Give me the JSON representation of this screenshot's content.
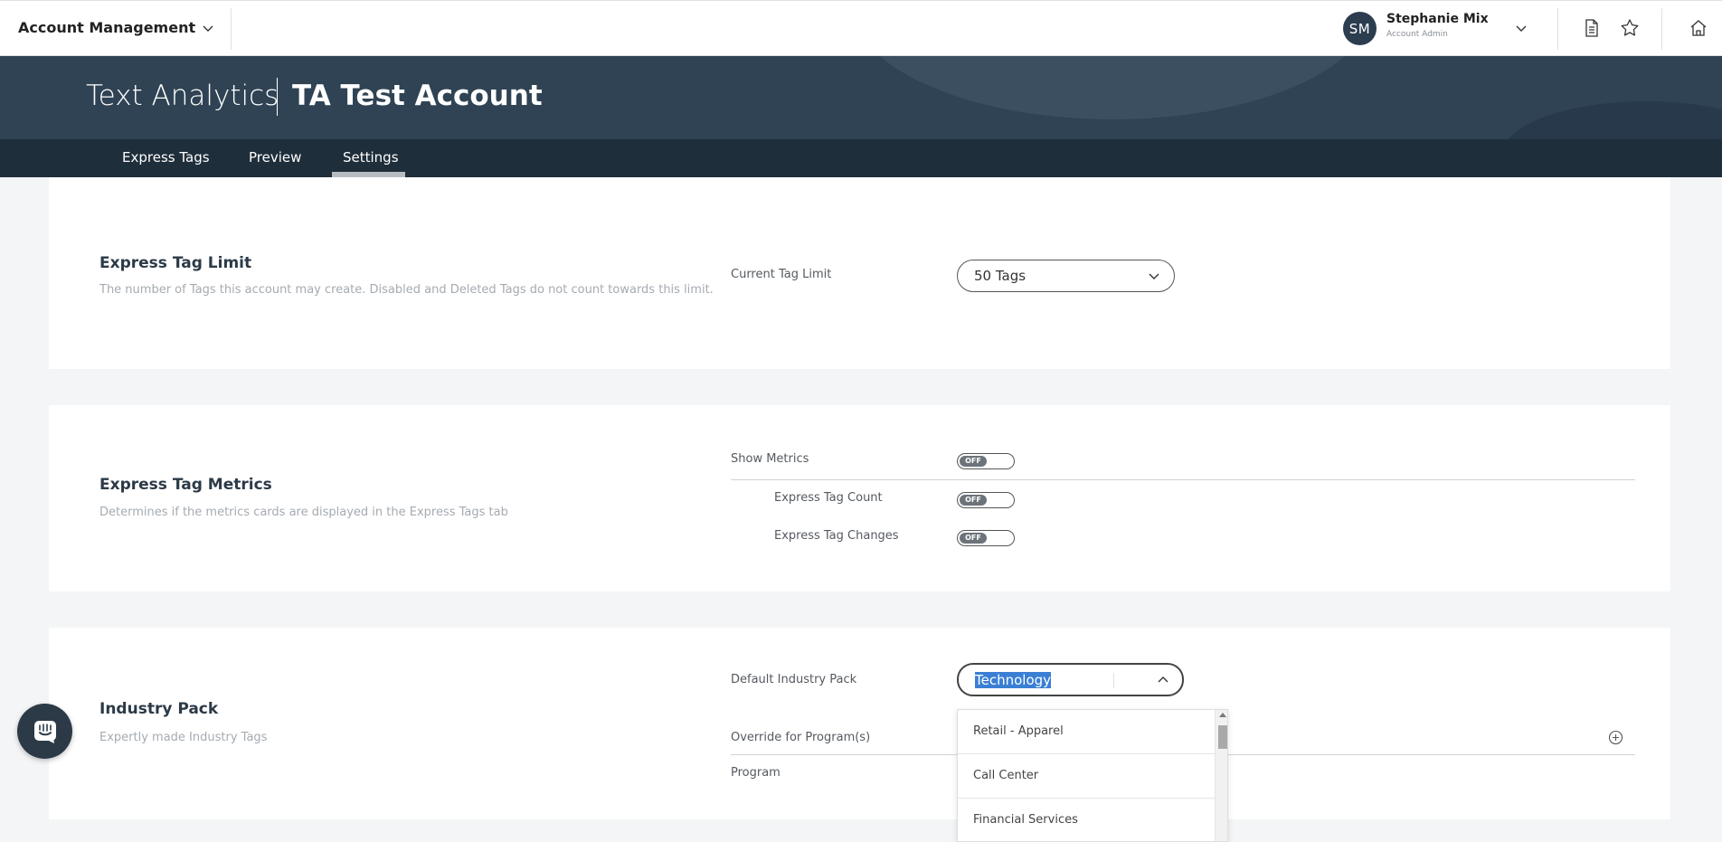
{
  "topbar": {
    "app_menu_label": "Account Management",
    "user": {
      "initials": "SM",
      "name": "Stephanie Mix",
      "role": "Account Admin"
    },
    "icons": [
      "chevron-down-icon",
      "document-icon",
      "star-icon",
      "home-icon"
    ]
  },
  "banner": {
    "product": "Text Analytics",
    "account": "TA Test Account"
  },
  "tabs": [
    {
      "label": "Express Tags",
      "active": false
    },
    {
      "label": "Preview",
      "active": false
    },
    {
      "label": "Settings",
      "active": true
    }
  ],
  "express_tag_limit": {
    "title": "Express Tag Limit",
    "description": "The number of Tags this account may create. Disabled and Deleted Tags do not count towards this limit.",
    "field_label": "Current Tag Limit",
    "value": "50 Tags"
  },
  "express_tag_metrics": {
    "title": "Express Tag Metrics",
    "description": "Determines if the metrics cards are displayed in the Express Tags tab",
    "toggles": [
      {
        "label": "Show Metrics",
        "state": "OFF"
      },
      {
        "label": "Express Tag Count",
        "state": "OFF"
      },
      {
        "label": "Express Tag Changes",
        "state": "OFF"
      }
    ]
  },
  "industry_pack": {
    "title": "Industry Pack",
    "description": "Expertly made Industry Tags",
    "default_label": "Default Industry Pack",
    "default_value": "Technology",
    "override_label": "Override for Program(s)",
    "program_label": "Program",
    "dropdown_options": [
      "Retail - Apparel",
      "Call Center",
      "Financial Services"
    ]
  },
  "colors": {
    "banner": "#2f4354",
    "tabs_bar": "#1f2e3b",
    "selection": "#3a7fd4"
  }
}
